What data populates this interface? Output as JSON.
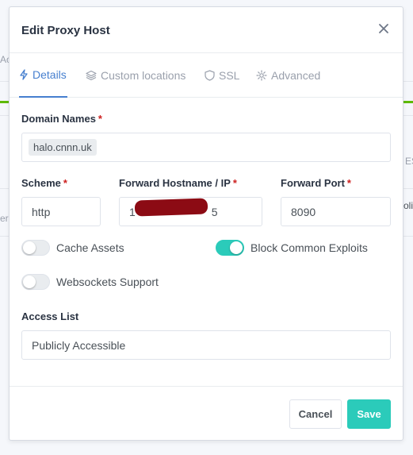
{
  "modal": {
    "title": "Edit Proxy Host"
  },
  "tabs": [
    {
      "label": "Details",
      "icon": "bolt-icon",
      "active": true
    },
    {
      "label": "Custom locations",
      "icon": "layers-icon",
      "active": false
    },
    {
      "label": "SSL",
      "icon": "shield-icon",
      "active": false
    },
    {
      "label": "Advanced",
      "icon": "gear-icon",
      "active": false
    }
  ],
  "form": {
    "domain_names": {
      "label": "Domain Names",
      "required": "*",
      "chips": [
        "halo.cnnn.uk"
      ]
    },
    "scheme": {
      "label": "Scheme",
      "required": "*",
      "value": "http"
    },
    "forward_host": {
      "label": "Forward Hostname / IP",
      "required": "*",
      "value_prefix": "1",
      "value_suffix": "5"
    },
    "forward_port": {
      "label": "Forward Port",
      "required": "*",
      "value": "8090"
    },
    "toggles": {
      "cache_assets": {
        "label": "Cache Assets",
        "on": false
      },
      "block_exploits": {
        "label": "Block Common Exploits",
        "on": true
      },
      "websockets": {
        "label": "Websockets Support",
        "on": false
      }
    },
    "access_list": {
      "label": "Access List",
      "value": "Publicly Accessible"
    }
  },
  "footer": {
    "cancel_label": "Cancel",
    "save_label": "Save"
  },
  "background": {
    "left_fragment_1": "Ac",
    "left_fragment_2": "er",
    "right_fragment_1": "ES",
    "right_fragment_2": "olic"
  },
  "colors": {
    "accent": "#467fcf",
    "primary": "#2bcbba",
    "required": "#cd201f",
    "redaction": "#8c0b14"
  }
}
